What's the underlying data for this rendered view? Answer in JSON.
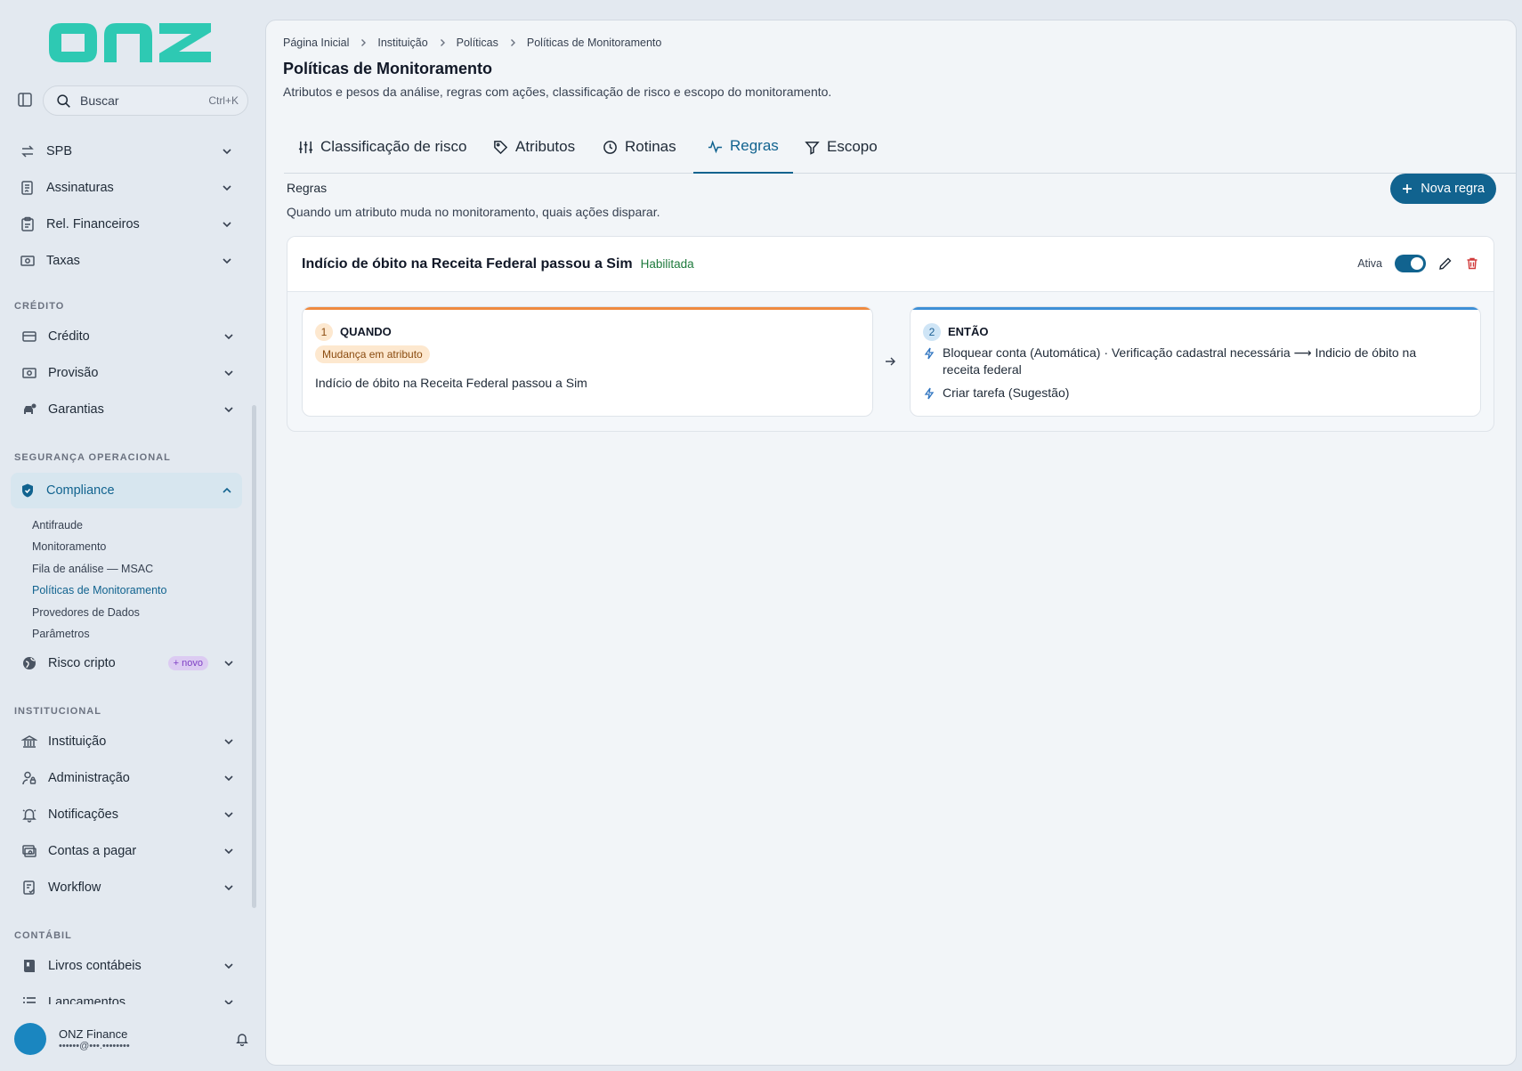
{
  "brand": {
    "logo_text": "onz",
    "accent": "#2ec9b3",
    "primary": "#11638f"
  },
  "search": {
    "label": "Buscar",
    "shortcut": "Ctrl+K"
  },
  "sidebar": {
    "top_items": [
      {
        "label": "SPB",
        "icon": "arrows-exchange-icon"
      },
      {
        "label": "Assinaturas",
        "icon": "signature-doc-icon"
      },
      {
        "label": "Rel. Financeiros",
        "icon": "clipboard-report-icon"
      },
      {
        "label": "Taxas",
        "icon": "money-icon"
      }
    ],
    "sections": {
      "credito": {
        "title": "CRÉDITO",
        "items": [
          {
            "label": "Crédito",
            "icon": "credit-card-icon"
          },
          {
            "label": "Provisão",
            "icon": "money-icon"
          },
          {
            "label": "Garantias",
            "icon": "car-guarantee-icon"
          }
        ]
      },
      "seguranca": {
        "title": "SEGURANÇA OPERACIONAL",
        "compliance": {
          "label": "Compliance",
          "icon": "shield-icon"
        },
        "sub_items": [
          "Antifraude",
          "Monitoramento",
          "Fila de análise — MSAC",
          "Políticas de Monitoramento",
          "Provedores de Dados",
          "Parâmetros"
        ],
        "risco": {
          "label": "Risco cripto",
          "badge": "+ novo",
          "icon": "globe-icon"
        }
      },
      "institucional": {
        "title": "INSTITUCIONAL",
        "items": [
          {
            "label": "Instituição",
            "icon": "bank-icon"
          },
          {
            "label": "Administração",
            "icon": "user-lock-icon"
          },
          {
            "label": "Notificações",
            "icon": "bell-icon"
          },
          {
            "label": "Contas a pagar",
            "icon": "bill-icon"
          },
          {
            "label": "Workflow",
            "icon": "workflow-doc-icon"
          }
        ]
      },
      "contabil": {
        "title": "CONTÁBIL",
        "items": [
          {
            "label": "Livros contábeis",
            "icon": "book-icon"
          },
          {
            "label": "Lançamentos",
            "icon": "list-icon"
          }
        ]
      }
    }
  },
  "user": {
    "name": "ONZ Finance",
    "email": "••••••@•••.••••••••"
  },
  "breadcrumb": [
    "Página Inicial",
    "Instituição",
    "Políticas",
    "Políticas de Monitoramento"
  ],
  "page": {
    "title": "Políticas de Monitoramento",
    "subtitle": "Atributos e pesos da análise, regras com ações, classificação de risco e escopo do monitoramento."
  },
  "tabs": [
    {
      "label": "Classificação de risco",
      "icon": "sliders-icon"
    },
    {
      "label": "Atributos",
      "icon": "tag-icon"
    },
    {
      "label": "Rotinas",
      "icon": "clock-icon"
    },
    {
      "label": "Regras",
      "icon": "activity-icon",
      "active": true
    },
    {
      "label": "Escopo",
      "icon": "filter-icon"
    }
  ],
  "rules": {
    "heading": "Regras",
    "description": "Quando um atributo muda no monitoramento, quais ações disparar.",
    "new_button": "Nova regra",
    "card": {
      "title": "Indício de óbito na Receita Federal passou a Sim",
      "status": "Habilitada",
      "active_label": "Ativa",
      "active": true,
      "when": {
        "step": "1",
        "heading": "QUANDO",
        "tag": "Mudança em atributo",
        "text": "Indício de óbito na Receita Federal passou a Sim"
      },
      "then": {
        "step": "2",
        "heading": "ENTÃO",
        "actions": [
          "Bloquear conta (Automática) · Verificação cadastral necessária ⟶ Indicio de óbito na receita federal",
          "Criar tarefa (Sugestão)"
        ]
      }
    }
  }
}
